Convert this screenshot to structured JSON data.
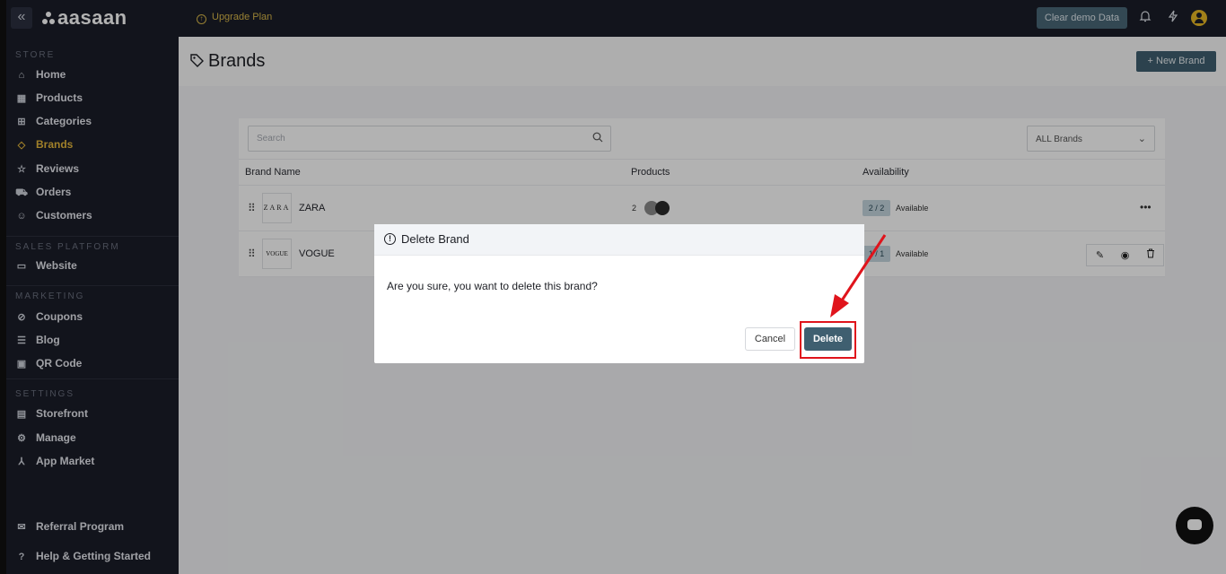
{
  "topbar": {
    "collapse_glyph": "«",
    "logo": "aasaan",
    "upgrade_label": "Upgrade Plan",
    "clear_demo_label": "Clear demo Data"
  },
  "sidebar": {
    "sections": [
      {
        "title": "STORE",
        "items": [
          {
            "label": "Home",
            "icon": "home-icon"
          },
          {
            "label": "Products",
            "icon": "products-icon"
          },
          {
            "label": "Categories",
            "icon": "categories-icon"
          },
          {
            "label": "Brands",
            "icon": "tag-icon",
            "active": true
          },
          {
            "label": "Reviews",
            "icon": "reviews-icon"
          },
          {
            "label": "Orders",
            "icon": "cart-icon"
          },
          {
            "label": "Customers",
            "icon": "customers-icon"
          }
        ]
      },
      {
        "title": "SALES PLATFORM",
        "items": [
          {
            "label": "Website",
            "icon": "monitor-icon"
          }
        ]
      },
      {
        "title": "MARKETING",
        "items": [
          {
            "label": "Coupons",
            "icon": "coupon-icon"
          },
          {
            "label": "Blog",
            "icon": "blog-icon"
          },
          {
            "label": "QR Code",
            "icon": "qr-icon"
          }
        ]
      },
      {
        "title": "SETTINGS",
        "items": [
          {
            "label": "Storefront",
            "icon": "storefront-icon"
          },
          {
            "label": "Manage",
            "icon": "gear-icon"
          },
          {
            "label": "App Market",
            "icon": "app-market-icon"
          }
        ]
      }
    ],
    "footer": [
      {
        "label": "Referral Program",
        "icon": "referral-icon"
      },
      {
        "label": "Help & Getting Started",
        "icon": "help-icon"
      }
    ]
  },
  "page": {
    "title": "Brands",
    "new_brand_label": "+ New Brand",
    "search_placeholder": "Search",
    "filter_value": "ALL Brands",
    "columns": [
      "Brand Name",
      "Products",
      "Availability"
    ],
    "rows": [
      {
        "logo_text": "ZARA",
        "name": "ZARA",
        "products": "2",
        "availability_badge": "2 / 2",
        "availability": "Available"
      },
      {
        "logo_text": "VOGUE",
        "name": "VOGUE",
        "products": "",
        "availability_badge": "1 / 1",
        "availability": "Available"
      }
    ]
  },
  "modal": {
    "title": "Delete Brand",
    "message": "Are you sure, you want to delete this brand?",
    "cancel_label": "Cancel",
    "delete_label": "Delete"
  },
  "colors": {
    "sidebar_bg": "#1b1e29",
    "accent": "#e6b83b",
    "primary_button": "#3f5f70",
    "highlight": "#e0141c"
  }
}
